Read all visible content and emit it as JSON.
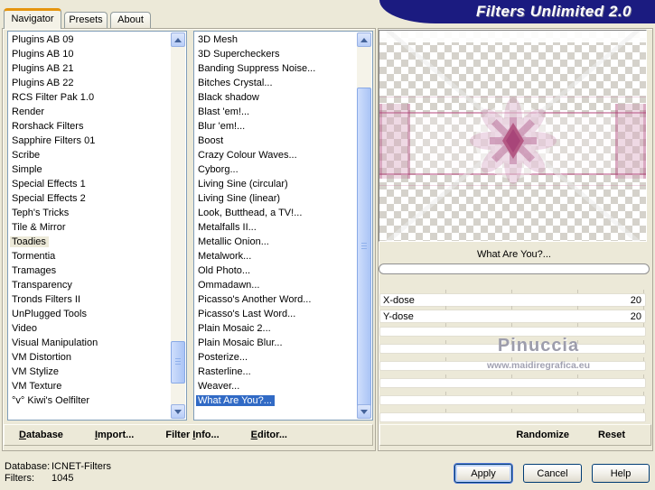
{
  "window": {
    "title": "Filters Unlimited 2.0"
  },
  "colors": {
    "banner_navy": "#1b1b80",
    "selection_blue": "#316ac5",
    "tab_accent_orange": "#e5950e",
    "dialog_beige": "#ece9d8"
  },
  "tabs": {
    "navigator": "Navigator",
    "presets": "Presets",
    "about": "About"
  },
  "category_list": {
    "selected": "Toadies",
    "items": [
      "Plugins AB 09",
      "Plugins AB 10",
      "Plugins AB 21",
      "Plugins AB 22",
      "RCS Filter Pak 1.0",
      "Render",
      "Rorshack Filters",
      "Sapphire Filters 01",
      "Scribe",
      "Simple",
      "Special Effects 1",
      "Special Effects 2",
      "Teph's Tricks",
      "Tile & Mirror",
      "Toadies",
      "Tormentia",
      "Tramages",
      "Transparency",
      "Tronds Filters II",
      "UnPlugged Tools",
      "Video",
      "Visual Manipulation",
      "VM Distortion",
      "VM Stylize",
      "VM Texture",
      "°v° Kiwi's Oelfilter"
    ]
  },
  "filter_list": {
    "selected": "What Are You?...",
    "items": [
      "3D Mesh",
      "3D Supercheckers",
      "Banding Suppress Noise...",
      "Bitches Crystal...",
      "Black shadow",
      "Blast 'em!...",
      "Blur 'em!...",
      "Boost",
      "Crazy Colour Waves...",
      "Cyborg...",
      "Living Sine (circular)",
      "Living Sine (linear)",
      "Look, Butthead, a TV!...",
      "Metalfalls II...",
      "Metallic Onion...",
      "Metalwork...",
      "Old Photo...",
      "Ommadawn...",
      "Picasso's Another Word...",
      "Picasso's Last Word...",
      "Plain Mosaic 2...",
      "Plain Mosaic Blur...",
      "Posterize...",
      "Rasterline...",
      "Weaver...",
      "What Are You?..."
    ]
  },
  "controls": {
    "filter_name": "What Are You?...",
    "sliders": [
      {
        "label": "X-dose",
        "value": "20"
      },
      {
        "label": "Y-dose",
        "value": "20"
      }
    ]
  },
  "watermark": {
    "name": "Pinuccia",
    "url": "www.maidiregrafica.eu"
  },
  "toolbar": {
    "database": {
      "key": "D",
      "post": "atabase"
    },
    "import": {
      "key": "I",
      "post": "mport..."
    },
    "filter_info": {
      "pre": "Filter ",
      "key": "I",
      "post": "nfo..."
    },
    "editor": {
      "key": "E",
      "post": "ditor..."
    },
    "randomize": "Randomize",
    "reset": "Reset"
  },
  "status": {
    "database_label": "Database:",
    "database_value": "ICNET-Filters",
    "filters_label": "Filters:",
    "filters_value": "1045"
  },
  "buttons": {
    "apply": "Apply",
    "cancel": "Cancel",
    "help": "Help"
  }
}
